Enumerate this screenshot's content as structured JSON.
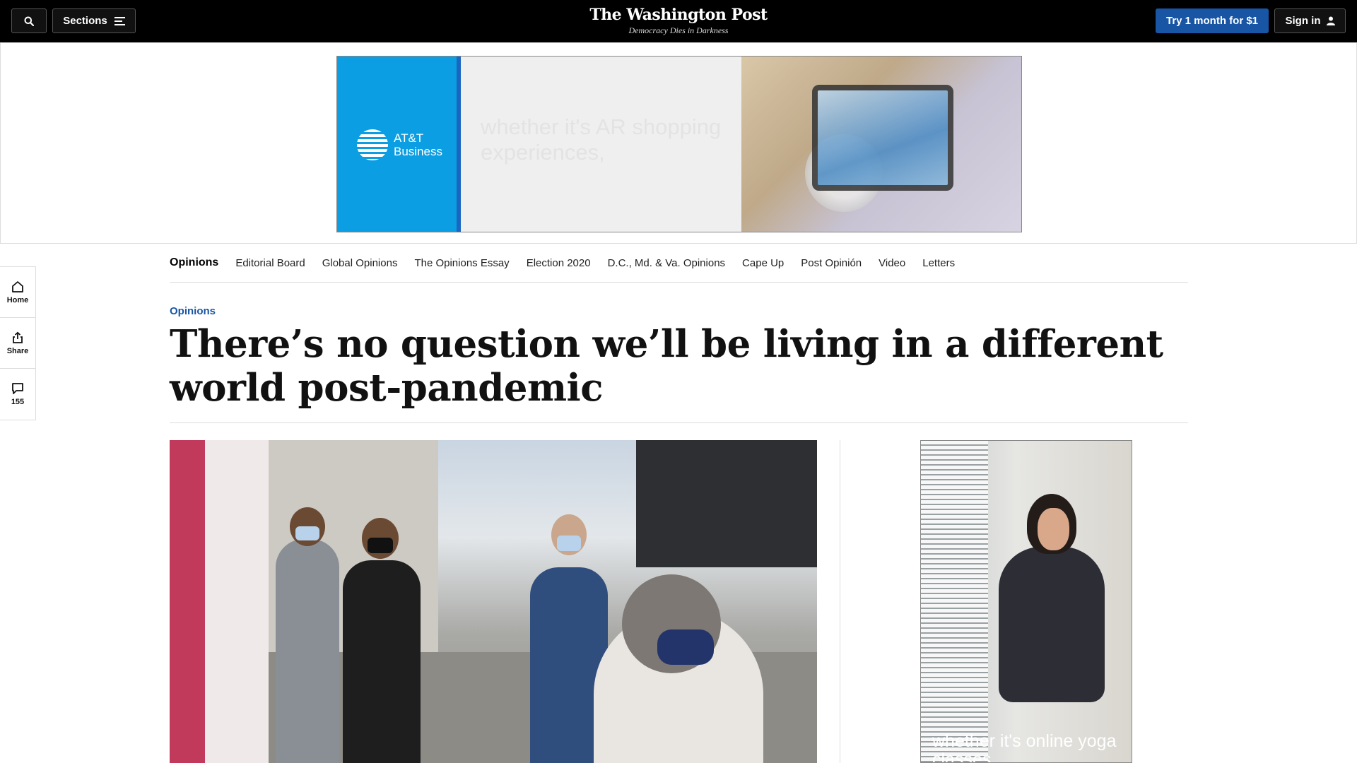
{
  "topbar": {
    "sections_label": "Sections",
    "logo": "The Washington Post",
    "tagline": "Democracy Dies in Darkness",
    "try_label": "Try 1 month for $1",
    "signin_label": "Sign in"
  },
  "top_ad": {
    "brand_line1": "AT&T",
    "brand_line2": "Business",
    "message": "whether it's AR shopping experiences,"
  },
  "section_nav": {
    "items": [
      {
        "label": "Opinions"
      },
      {
        "label": "Editorial Board"
      },
      {
        "label": "Global Opinions"
      },
      {
        "label": "The Opinions Essay"
      },
      {
        "label": "Election 2020"
      },
      {
        "label": "D.C., Md. & Va. Opinions"
      },
      {
        "label": "Cape Up"
      },
      {
        "label": "Post Opinión"
      },
      {
        "label": "Video"
      },
      {
        "label": "Letters"
      }
    ]
  },
  "rail": {
    "home_label": "Home",
    "share_label": "Share",
    "comments_count": "155"
  },
  "article": {
    "kicker": "Opinions",
    "headline": "There’s no question we’ll be living in a different world post-pandemic"
  },
  "side_ad": {
    "message": "whether it's online yoga classes,"
  },
  "colors": {
    "topbar_bg": "#000000",
    "accent_blue": "#1955a5",
    "att_blue": "#0c9ee2"
  }
}
